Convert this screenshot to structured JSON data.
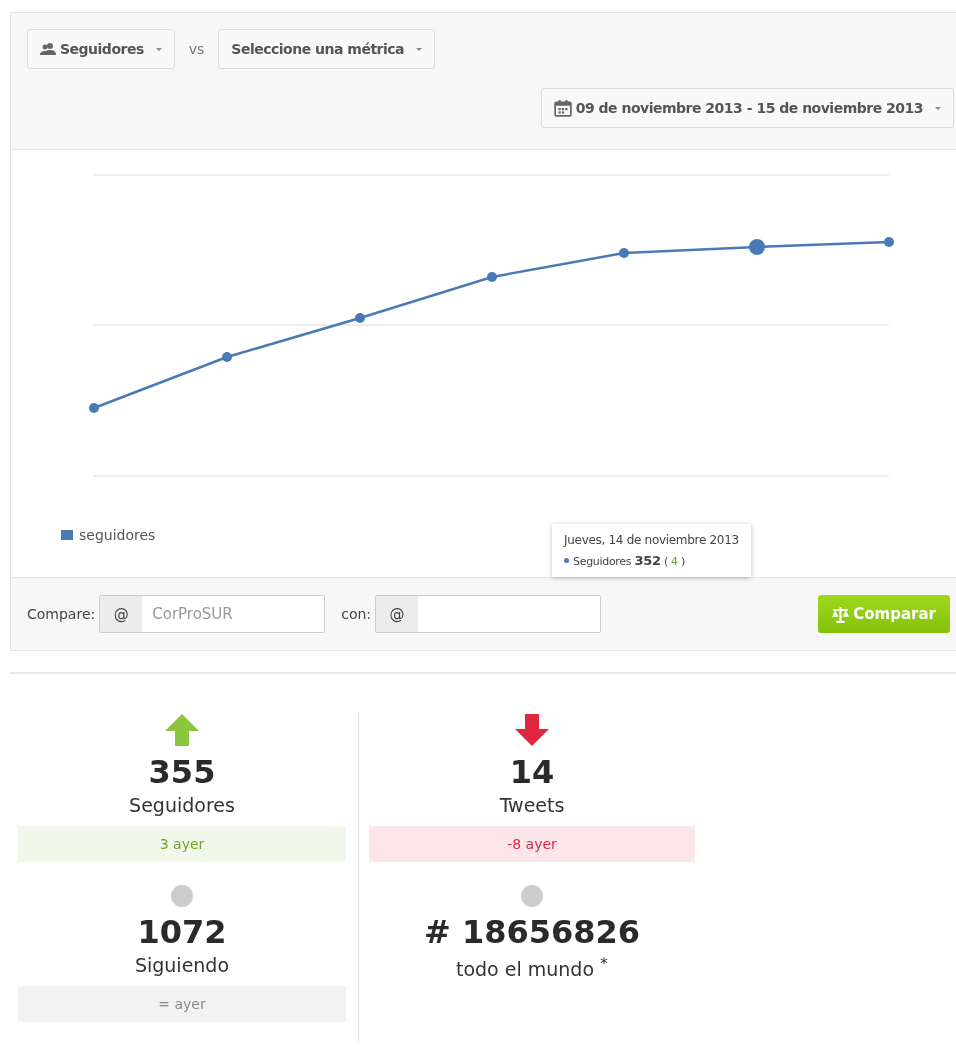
{
  "toolbar": {
    "metric": "Seguidores",
    "vs": "vs",
    "second_metric": "Seleccione una métrica",
    "date_range": "09 de noviembre 2013 - 15 de noviembre 2013"
  },
  "chart": {
    "legend": "seguidores",
    "tooltip": {
      "date": "Jueves, 14 de noviembre 2013",
      "series": "Seguidores",
      "value": "352",
      "open": "(",
      "delta": "4",
      "close": ")"
    }
  },
  "compare": {
    "label": "Compare:",
    "prefix": "@",
    "placeholder": "CorProSUR",
    "with_label": "con:",
    "with_prefix": "@",
    "button": "Comparar"
  },
  "stat_columns": [
    {
      "stats": [
        {
          "kind": "up",
          "value": "355",
          "label": "Seguidores",
          "change": "3 ayer"
        },
        {
          "kind": "same",
          "value": "1072",
          "label": "Siguiendo",
          "change": "= ayer"
        }
      ]
    },
    {
      "stats": [
        {
          "kind": "down",
          "value": "14",
          "label": "Tweets",
          "change": "-8 ayer"
        },
        {
          "kind": "same",
          "value": "# 18656826",
          "label": "todo el mundo $^{*}$"
        }
      ]
    }
  ]
}
